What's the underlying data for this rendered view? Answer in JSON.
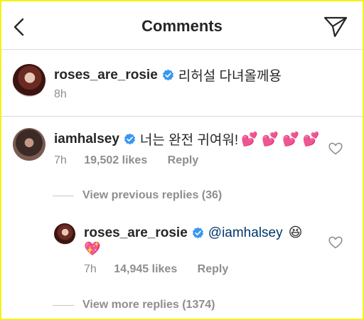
{
  "header": {
    "title": "Comments",
    "back_icon": "chevron-left-icon",
    "send_icon": "paper-plane-icon"
  },
  "caption": {
    "username": "roses_are_rosie",
    "text": "리허설 다녀올께용",
    "time": "8h"
  },
  "comment": {
    "username": "iamhalsey",
    "text": "너는 완전 귀여워!",
    "emoji": "💕 💕 💕 💕",
    "time": "7h",
    "likes": "19,502 likes",
    "reply_label": "Reply",
    "view_previous": "View previous replies (36)"
  },
  "reply": {
    "username": "roses_are_rosie",
    "mention": "@iamhalsey",
    "emoji_1": "😆",
    "emoji_2": "💖",
    "time": "7h",
    "likes": "14,945 likes",
    "reply_label": "Reply",
    "view_more": "View more replies (1374)"
  },
  "colors": {
    "verified": "#3897f0",
    "muted": "#8e8e8e",
    "mention": "#00376b",
    "divider": "#dbdbdb"
  }
}
